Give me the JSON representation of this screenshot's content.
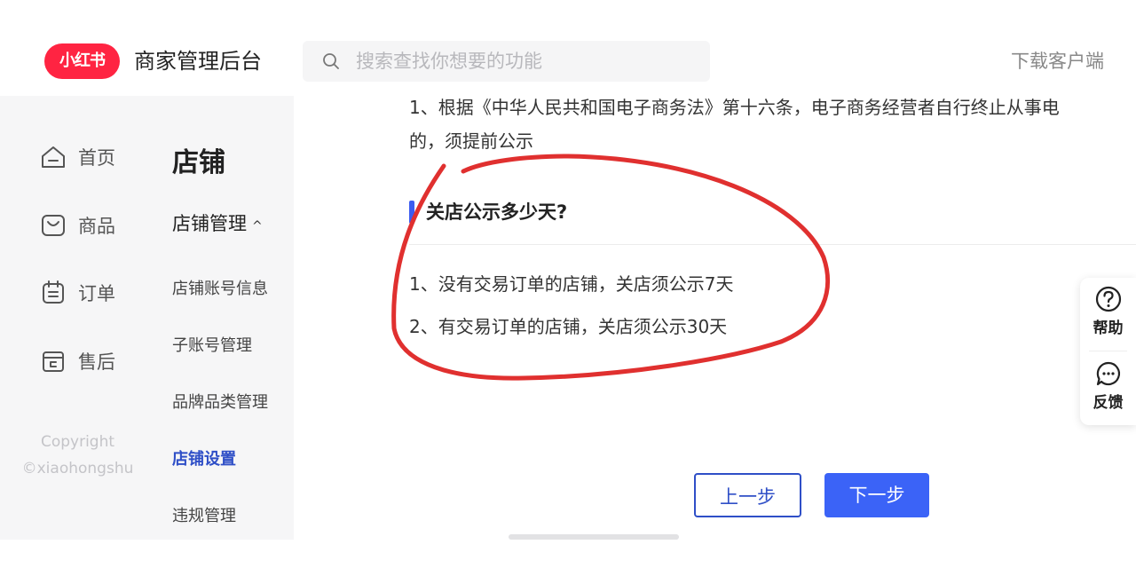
{
  "header": {
    "logo_text": "小红书",
    "title": "商家管理后台",
    "search_placeholder": "搜索查找你想要的功能",
    "download_label": "下载客户端"
  },
  "leftnav": {
    "items": [
      {
        "label": "首页",
        "icon": "home-icon"
      },
      {
        "label": "商品",
        "icon": "bag-icon"
      },
      {
        "label": "订单",
        "icon": "clipboard-icon"
      },
      {
        "label": "售后",
        "icon": "return-box-icon"
      }
    ],
    "copyright_line1": "Copyright",
    "copyright_line2": "©xiaohongshu"
  },
  "subnav": {
    "title": "店铺",
    "group_label": "店铺管理",
    "group_chevron": "^",
    "items": [
      {
        "label": "店铺账号信息"
      },
      {
        "label": "子账号管理"
      },
      {
        "label": "品牌品类管理"
      },
      {
        "label": "店铺设置",
        "active": true
      },
      {
        "label": "违规管理"
      }
    ]
  },
  "main": {
    "para_line1": "1、根据《中华人民共和国电子商务法》第十六条，电子商务经营者自行终止从事电",
    "para_line2": "的，须提前公示",
    "section_title": "关店公示多少天?",
    "answers": [
      "1、没有交易订单的店铺，关店须公示7天",
      "2、有交易订单的店铺，关店须公示30天"
    ],
    "prev_label": "上一步",
    "next_label": "下一步"
  },
  "float_panel": {
    "help_label": "帮助",
    "feedback_label": "反馈"
  },
  "colors": {
    "brand_red": "#ff2442",
    "accent_blue": "#3b63f7",
    "active_nav": "#2f4fc7",
    "annotation_red": "#e0302f"
  }
}
